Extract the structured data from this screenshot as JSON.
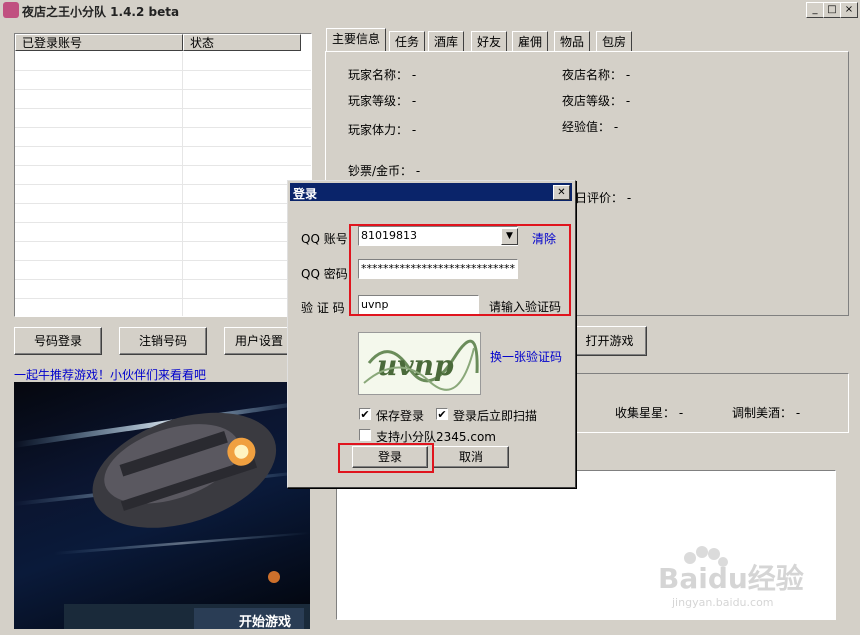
{
  "window": {
    "title": "夜店之王小分队 1.4.2 beta",
    "controls": [
      "_",
      "□",
      "×"
    ]
  },
  "account_list": {
    "headers": [
      "已登录账号",
      "状态"
    ],
    "rows": []
  },
  "buttons": {
    "code_login": "号码登录",
    "logout": "注销号码",
    "user_settings": "用户设置",
    "open_game": "打开游戏"
  },
  "tabs": [
    "主要信息",
    "任务",
    "酒库",
    "好友",
    "雇佣",
    "物品",
    "包房"
  ],
  "main_info": {
    "player_name": "玩家名称：  -",
    "player_level": "玩家等级：  -",
    "player_stamina": "玩家体力：  -",
    "cash_gold": "钞票/金币：  -",
    "club_name": "夜店名称：  -",
    "club_level": "夜店等级：  -",
    "exp": "经验值：   -",
    "daily_rating_fragment": "日评价：  -"
  },
  "stats": {
    "collect_stars": "收集星星：  -",
    "brew_wine": "调制美酒：  -"
  },
  "ad": {
    "link_text": "一起牛推荐游戏！小伙伴们来看看吧",
    "banner_text": "开始游戏"
  },
  "login_dialog": {
    "title": "登录",
    "qq_account_label": "QQ 账号",
    "qq_account_value": "81019813",
    "clear_link": "清除",
    "qq_password_label": "QQ 密码",
    "qq_password_value": "****************************",
    "captcha_label": "验 证 码",
    "captcha_value": "uvnp",
    "captcha_hint": "请输入验证码",
    "captcha_image_text": "uvnp",
    "refresh_captcha": "换一张验证码",
    "save_login": "保存登录",
    "save_login_checked": true,
    "scan_after_login": "登录后立即扫描",
    "scan_after_login_checked": true,
    "support_team": "支持小分队2345.com",
    "support_team_checked": false,
    "login_button": "登录",
    "cancel_button": "取消"
  },
  "watermark": {
    "brand": "Baidu经验",
    "url": "jingyan.baidu.com"
  },
  "colors": {
    "window_bg": "#d4d0c8",
    "dialog_title_bg": "#0a246a",
    "highlight_red": "#e0141e",
    "link_blue": "#0000cc"
  }
}
